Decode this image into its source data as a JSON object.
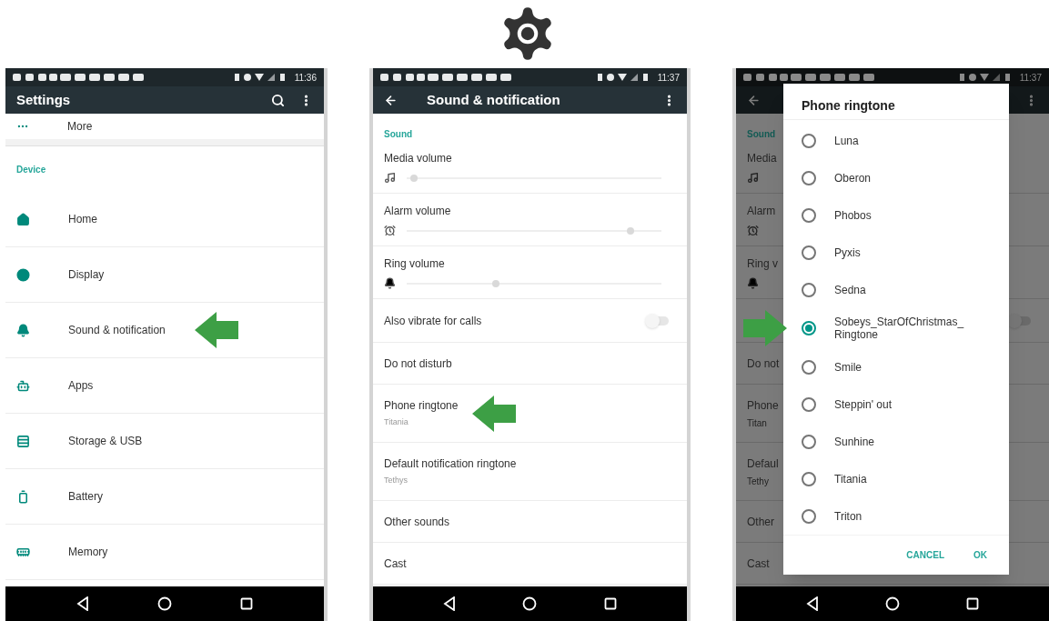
{
  "settings_screen": {
    "time": "11:36",
    "title": "Settings",
    "top_item": {
      "label": "More"
    },
    "section": "Device",
    "items": [
      {
        "label": "Home",
        "pointed": false
      },
      {
        "label": "Display",
        "pointed": false
      },
      {
        "label": "Sound & notification",
        "pointed": true
      },
      {
        "label": "Apps",
        "pointed": false
      },
      {
        "label": "Storage & USB",
        "pointed": false
      },
      {
        "label": "Battery",
        "pointed": false
      },
      {
        "label": "Memory",
        "pointed": false
      }
    ]
  },
  "sound_screen": {
    "time": "11:37",
    "title": "Sound & notification",
    "section": "Sound",
    "rows": [
      {
        "kind": "slider",
        "label": "Media volume",
        "level": 0.03,
        "pointed": false
      },
      {
        "kind": "slider",
        "label": "Alarm volume",
        "level": 0.88,
        "pointed": false
      },
      {
        "kind": "slider",
        "label": "Ring volume",
        "level": 0.35,
        "pointed": false
      },
      {
        "kind": "switch",
        "label": "Also vibrate for calls",
        "on": false,
        "pointed": false
      },
      {
        "kind": "plain",
        "label": "Do not disturb",
        "pointed": false
      },
      {
        "kind": "plain",
        "label": "Phone ringtone",
        "summary": "Titania",
        "pointed": true
      },
      {
        "kind": "plain",
        "label": "Default notification ringtone",
        "summary": "Tethys",
        "pointed": false
      },
      {
        "kind": "plain",
        "label": "Other sounds",
        "pointed": false
      },
      {
        "kind": "plain",
        "label": "Cast",
        "pointed": false
      }
    ]
  },
  "ringtone_screen": {
    "time": "11:37",
    "background": {
      "section": "Sound",
      "rows": [
        {
          "kind": "slider",
          "label": "Media"
        },
        {
          "kind": "slider",
          "label": "Alarm"
        },
        {
          "kind": "slider",
          "label": "Ring v"
        },
        {
          "kind": "switch",
          "on": false
        },
        {
          "kind": "plain",
          "label": "Do not"
        },
        {
          "kind": "plain",
          "label": "Phone",
          "summary": "Titan"
        },
        {
          "kind": "plain",
          "label": "Defaul",
          "summary": "Tethy"
        },
        {
          "kind": "plain",
          "label": "Other"
        },
        {
          "kind": "plain",
          "label": "Cast"
        }
      ]
    },
    "dialog": {
      "title": "Phone ringtone",
      "options": [
        {
          "label": "Luna",
          "selected": false,
          "pointed": false
        },
        {
          "label": "Oberon",
          "selected": false,
          "pointed": false
        },
        {
          "label": "Phobos",
          "selected": false,
          "pointed": false
        },
        {
          "label": "Pyxis",
          "selected": false,
          "pointed": false
        },
        {
          "label": "Sedna",
          "selected": false,
          "pointed": false
        },
        {
          "label": "Sobeys_StarOfChristmas_ Ringtone",
          "selected": true,
          "pointed": true
        },
        {
          "label": "Smile",
          "selected": false,
          "pointed": false
        },
        {
          "label": "Steppin' out",
          "selected": false,
          "pointed": false
        },
        {
          "label": "Sunhine",
          "selected": false,
          "pointed": false
        },
        {
          "label": "Titania",
          "selected": false,
          "pointed": false
        },
        {
          "label": "Triton",
          "selected": false,
          "pointed": false
        }
      ],
      "buttons": [
        "CANCEL",
        "OK"
      ]
    }
  }
}
